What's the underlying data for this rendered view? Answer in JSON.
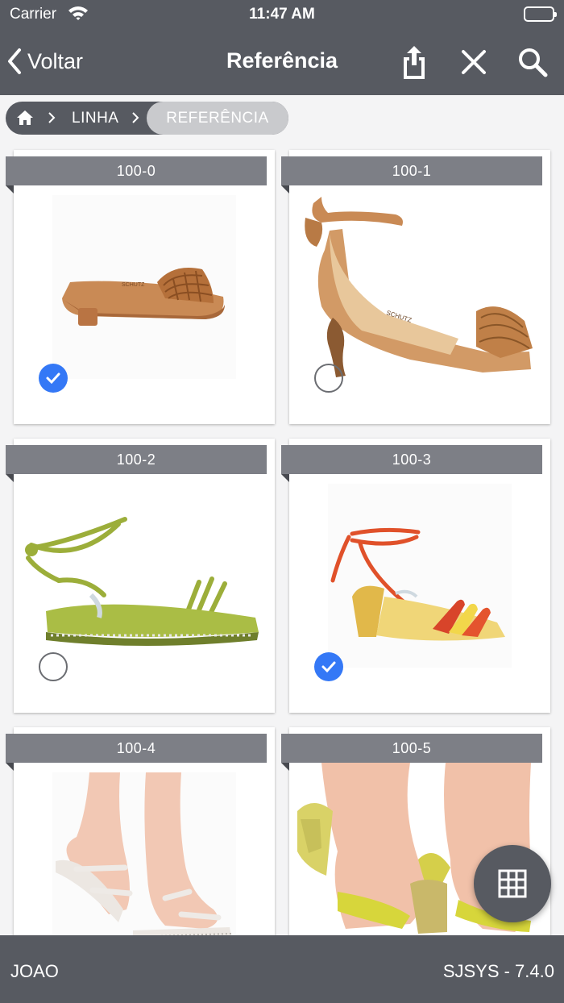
{
  "status_bar": {
    "carrier": "Carrier",
    "time": "11:47 AM",
    "battery_level": 1.0
  },
  "nav": {
    "back_label": "Voltar",
    "title": "Referência",
    "icons": [
      "share-icon",
      "close-icon",
      "search-icon"
    ]
  },
  "breadcrumb": {
    "home_icon": "home-icon",
    "items": [
      "LINHA"
    ],
    "current": "REFERÊNCIA"
  },
  "products": [
    {
      "code": "100-0",
      "selected": true,
      "image": "brown woven slide sandal"
    },
    {
      "code": "100-1",
      "selected": false,
      "image": "tan ankle-tie heeled sandal"
    },
    {
      "code": "100-2",
      "selected": true,
      "image": "green lace-up flat sandal"
    },
    {
      "code": "100-3",
      "selected": true,
      "image": "orange and gold block-heel sandal"
    },
    {
      "code": "100-4",
      "selected": false,
      "image": "white flat sandal on feet"
    },
    {
      "code": "100-5",
      "selected": false,
      "image": "yellow block-heel sandal on feet"
    }
  ],
  "fab": {
    "icon": "grid-hash-icon"
  },
  "footer": {
    "user": "JOAO",
    "version": "SJSYS - 7.4.0"
  },
  "colors": {
    "bar": "#575a61",
    "ribbon": "#7d7f86",
    "check_on": "#3478f6",
    "background": "#f4f4f5"
  }
}
